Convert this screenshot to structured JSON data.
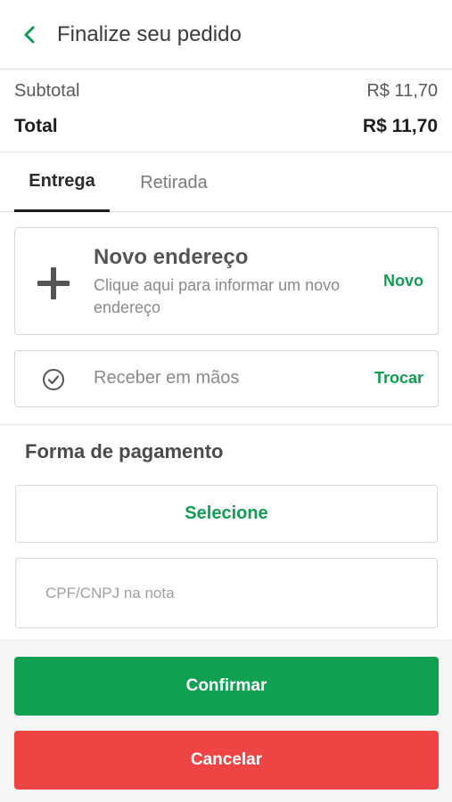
{
  "header": {
    "title": "Finalize seu pedido",
    "back_icon": "chevron-left-icon",
    "accent": "#119a4e"
  },
  "totals": {
    "subtotal_label": "Subtotal",
    "subtotal_value": "R$ 11,70",
    "total_label": "Total",
    "total_value": "R$ 11,70"
  },
  "tabs": [
    {
      "label": "Entrega",
      "active": true
    },
    {
      "label": "Retirada",
      "active": false
    }
  ],
  "delivery": {
    "new_address": {
      "icon": "plus-icon",
      "title": "Novo endereço",
      "description": "Clique aqui para informar um novo endereço",
      "action": "Novo"
    },
    "receive": {
      "icon": "check-circle-icon",
      "label": "Receber em mãos",
      "action": "Trocar"
    }
  },
  "payment": {
    "title": "Forma de pagamento",
    "select_label": "Selecione",
    "cpf_placeholder": "CPF/CNPJ na nota",
    "cpf_value": ""
  },
  "actions": {
    "confirm_label": "Confirmar",
    "cancel_label": "Cancelar"
  },
  "colors": {
    "green": "#10a052",
    "red": "#ef4444",
    "link_green": "#0f9d4f"
  }
}
